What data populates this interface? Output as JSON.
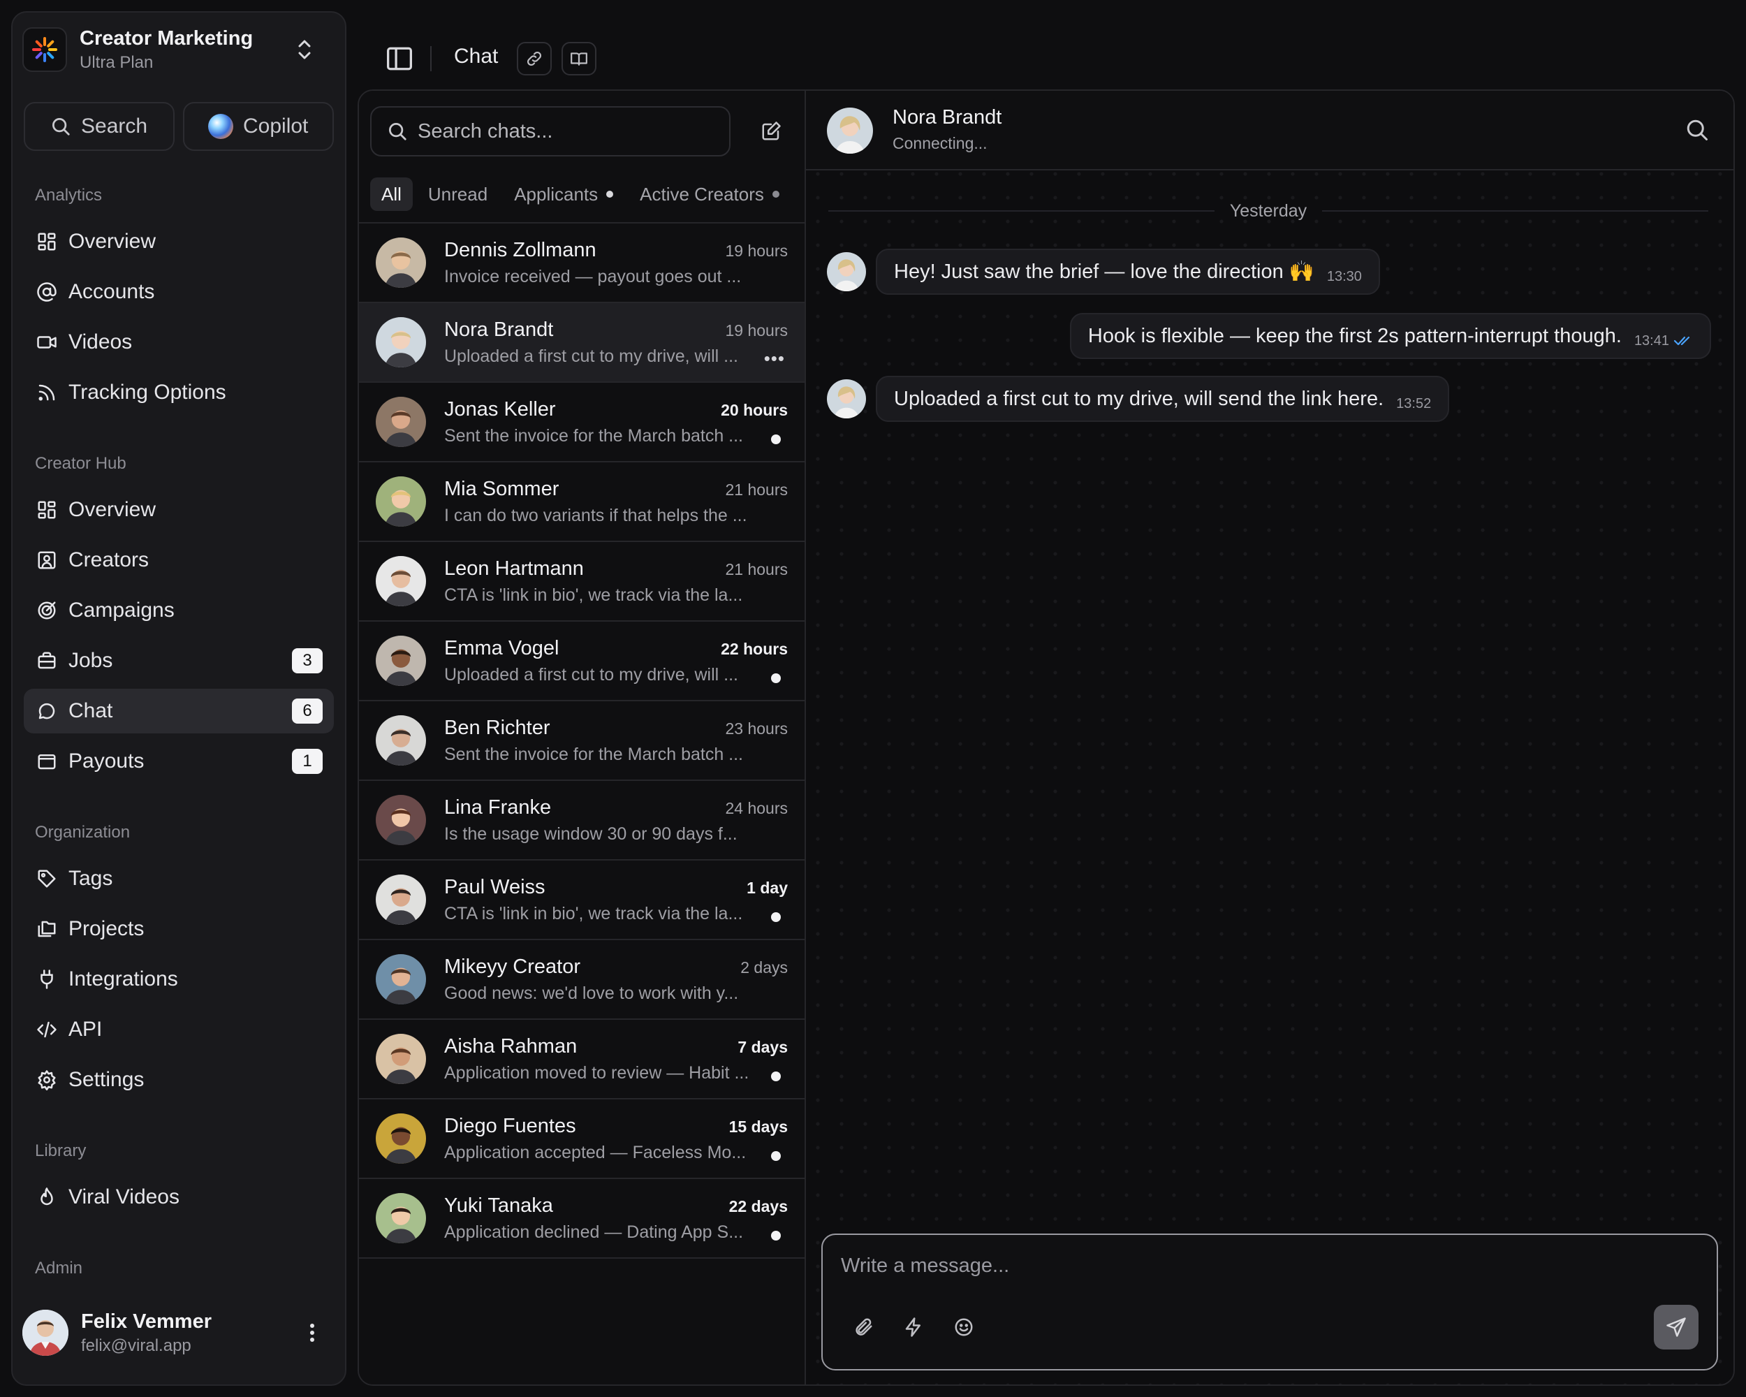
{
  "workspace": {
    "name": "Creator Marketing",
    "plan": "Ultra Plan"
  },
  "top_buttons": {
    "search": "Search",
    "copilot": "Copilot"
  },
  "sections": {
    "analytics": "Analytics",
    "creator_hub": "Creator Hub",
    "organization": "Organization",
    "library": "Library",
    "admin": "Admin"
  },
  "nav": {
    "analytics": [
      {
        "label": "Overview",
        "icon": "grid-icon"
      },
      {
        "label": "Accounts",
        "icon": "at-icon"
      },
      {
        "label": "Videos",
        "icon": "video-icon"
      },
      {
        "label": "Tracking Options",
        "icon": "rss-icon"
      }
    ],
    "creator_hub": [
      {
        "label": "Overview",
        "icon": "grid-icon"
      },
      {
        "label": "Creators",
        "icon": "contact-icon"
      },
      {
        "label": "Campaigns",
        "icon": "target-icon"
      },
      {
        "label": "Jobs",
        "icon": "briefcase-icon",
        "badge": "3"
      },
      {
        "label": "Chat",
        "icon": "chat-icon",
        "badge": "6",
        "active": true
      },
      {
        "label": "Payouts",
        "icon": "wallet-icon",
        "badge": "1"
      }
    ],
    "organization": [
      {
        "label": "Tags",
        "icon": "tag-icon"
      },
      {
        "label": "Projects",
        "icon": "folders-icon"
      },
      {
        "label": "Integrations",
        "icon": "plug-icon"
      },
      {
        "label": "API",
        "icon": "code-icon"
      },
      {
        "label": "Settings",
        "icon": "gear-icon"
      }
    ],
    "library": [
      {
        "label": "Viral Videos",
        "icon": "flame-icon"
      }
    ]
  },
  "user": {
    "name": "Felix Vemmer",
    "email": "felix@viral.app"
  },
  "topbar": {
    "title": "Chat"
  },
  "chat_list": {
    "search_placeholder": "Search chats...",
    "filters": [
      "All",
      "Unread",
      "Applicants",
      "Active Creators"
    ],
    "chats": [
      {
        "name": "Dennis Zollmann",
        "time": "19 hours",
        "preview": "Invoice received — payout goes out ...",
        "unread": false,
        "bg": "#c7b9a5",
        "skin": "#e8c3a0",
        "hair": "#8a6a4a"
      },
      {
        "name": "Nora Brandt",
        "time": "19 hours",
        "preview": "Uploaded a first cut to my drive, will ...",
        "unread": false,
        "selected": true,
        "bg": "#cfd8df",
        "skin": "#f1d2bd",
        "hair": "#d8c08a"
      },
      {
        "name": "Jonas Keller",
        "time": "20 hours",
        "preview": "Sent the invoice for the March batch ...",
        "unread": true,
        "bg": "#8d7766",
        "skin": "#d9a88a",
        "hair": "#5a3a28"
      },
      {
        "name": "Mia Sommer",
        "time": "21 hours",
        "preview": "I can do two variants if that helps the ...",
        "unread": false,
        "bg": "#9fb27b",
        "skin": "#f0c9a9",
        "hair": "#e3c27a"
      },
      {
        "name": "Leon Hartmann",
        "time": "21 hours",
        "preview": "CTA is 'link in bio', we track via the la...",
        "unread": false,
        "bg": "#e7e7e7",
        "skin": "#e6bda0",
        "hair": "#6b4c36"
      },
      {
        "name": "Emma Vogel",
        "time": "22 hours",
        "preview": "Uploaded a first cut to my drive, will ...",
        "unread": true,
        "bg": "#bfb7ae",
        "skin": "#8a5a3e",
        "hair": "#2a1b12"
      },
      {
        "name": "Ben Richter",
        "time": "23 hours",
        "preview": "Sent the invoice for the March batch ...",
        "unread": false,
        "bg": "#d8d8d6",
        "skin": "#d7ad92",
        "hair": "#3a2e28"
      },
      {
        "name": "Lina Franke",
        "time": "24 hours",
        "preview": "Is the usage window 30 or 90 days f...",
        "unread": false,
        "bg": "#6a4a4a",
        "skin": "#f0c6a8",
        "hair": "#5a2f1e"
      },
      {
        "name": "Paul Weiss",
        "time": "1 day",
        "preview": "CTA is 'link in bio', we track via the la...",
        "unread": true,
        "bg": "#e0e0de",
        "skin": "#d9a98c",
        "hair": "#2e241f"
      },
      {
        "name": "Mikeyy Creator",
        "time": "2 days",
        "preview": "Good news: we'd love to work with y...",
        "unread": false,
        "bg": "#6f8fa8",
        "skin": "#e2b394",
        "hair": "#4e3526"
      },
      {
        "name": "Aisha Rahman",
        "time": "7 days",
        "preview": "Application moved to review — Habit ...",
        "unread": true,
        "bg": "#d9c2a5",
        "skin": "#d19c78",
        "hair": "#5b3823"
      },
      {
        "name": "Diego Fuentes",
        "time": "15 days",
        "preview": "Application accepted — Faceless Mo...",
        "unread": true,
        "bg": "#c9a53a",
        "skin": "#7a4a30",
        "hair": "#1e140e"
      },
      {
        "name": "Yuki Tanaka",
        "time": "22 days",
        "preview": "Application declined — Dating App S...",
        "unread": true,
        "bg": "#a7bf8d",
        "skin": "#efcaa8",
        "hair": "#2b1d16"
      }
    ]
  },
  "conversation": {
    "contact_name": "Nora Brandt",
    "status": "Connecting...",
    "day_separator": "Yesterday",
    "messages": [
      {
        "text": "Hey! Just saw the brief — love the direction 🙌",
        "time": "13:30",
        "from": "contact"
      },
      {
        "text": "Hook is flexible — keep the first 2s pattern-interrupt though.",
        "time": "13:41",
        "from": "me",
        "read": true
      },
      {
        "text": "Uploaded a first cut to my drive, will send the link here.",
        "time": "13:52",
        "from": "contact"
      }
    ],
    "composer_placeholder": "Write a message..."
  },
  "colors": {
    "background": "#0e0e10",
    "sidebar": "#19191c",
    "accent_read": "#4aa3ff"
  }
}
